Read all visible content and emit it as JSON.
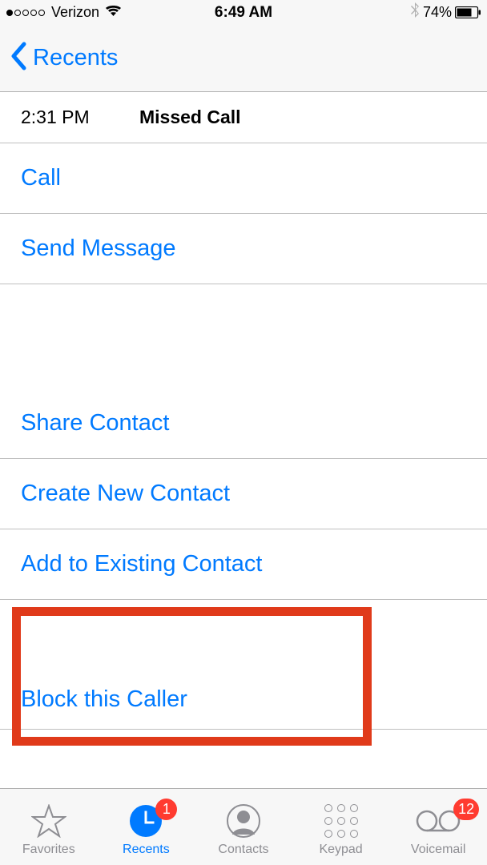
{
  "status": {
    "carrier": "Verizon",
    "time": "6:49 AM",
    "battery": "74%"
  },
  "nav": {
    "back_label": "Recents"
  },
  "call_log": {
    "time": "2:31 PM",
    "status": "Missed Call"
  },
  "actions": {
    "call": "Call",
    "send_message": "Send Message",
    "share_contact": "Share Contact",
    "create_contact": "Create New Contact",
    "add_existing": "Add to Existing Contact",
    "block": "Block this Caller"
  },
  "tabs": {
    "favorites": "Favorites",
    "recents": "Recents",
    "contacts": "Contacts",
    "keypad": "Keypad",
    "voicemail": "Voicemail",
    "recents_badge": "1",
    "voicemail_badge": "12"
  }
}
